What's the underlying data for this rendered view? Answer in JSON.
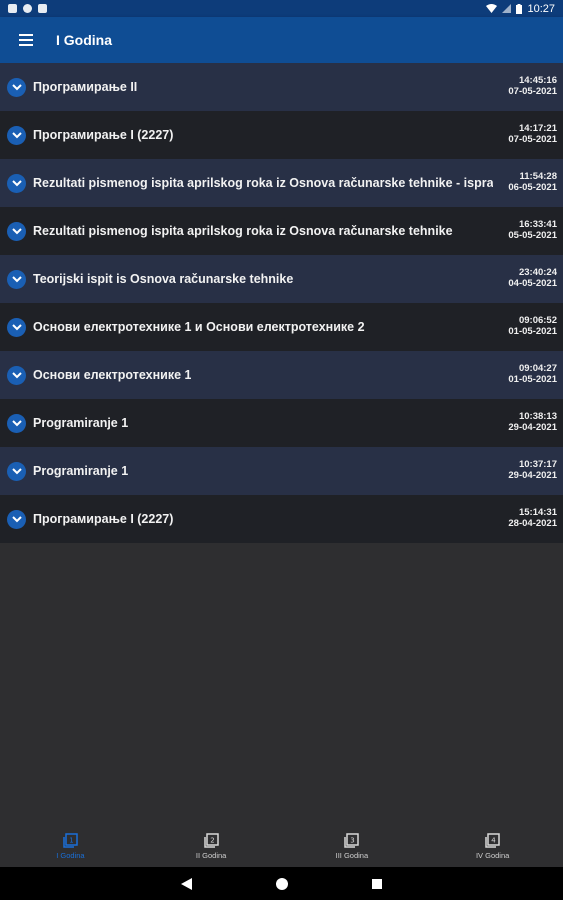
{
  "status_bar": {
    "time": "10:27"
  },
  "app_bar": {
    "title": "I Godina"
  },
  "items": [
    {
      "title": "Програмирање II",
      "time": "14:45:16",
      "date": "07-05-2021"
    },
    {
      "title": "Програмирање I (2227)",
      "time": "14:17:21",
      "date": "07-05-2021"
    },
    {
      "title": "Rezultati pismenog ispita aprilskog roka iz Osnova računarske tehnike - ispravka",
      "time": "11:54:28",
      "date": "06-05-2021"
    },
    {
      "title": "Rezultati pismenog ispita aprilskog roka iz Osnova računarske tehnike",
      "time": "16:33:41",
      "date": "05-05-2021"
    },
    {
      "title": "Teorijski ispit is Osnova računarske tehnike",
      "time": "23:40:24",
      "date": "04-05-2021"
    },
    {
      "title": "Основи електротехнике 1 и Основи електротехнике 2",
      "time": "09:06:52",
      "date": "01-05-2021"
    },
    {
      "title": "Основи електротехнике 1",
      "time": "09:04:27",
      "date": "01-05-2021"
    },
    {
      "title": "Programiranje 1",
      "time": "10:38:13",
      "date": "29-04-2021"
    },
    {
      "title": "Programiranje 1",
      "time": "10:37:17",
      "date": "29-04-2021"
    },
    {
      "title": "Програмирање I (2227)",
      "time": "15:14:31",
      "date": "28-04-2021"
    }
  ],
  "bottom_nav": [
    {
      "label": "I Godina",
      "icon": "book-1-icon",
      "active": true
    },
    {
      "label": "II Godina",
      "icon": "book-2-icon",
      "active": false
    },
    {
      "label": "III Godina",
      "icon": "book-3-icon",
      "active": false
    },
    {
      "label": "IV Godina",
      "icon": "book-4-icon",
      "active": false
    }
  ],
  "colors": {
    "app_bar": "#0f4d94",
    "status_bar": "#0d3c7a",
    "accent": "#1a6fd8",
    "row_odd": "#283046",
    "row_even": "#1f2126",
    "background": "#2e2e30"
  }
}
